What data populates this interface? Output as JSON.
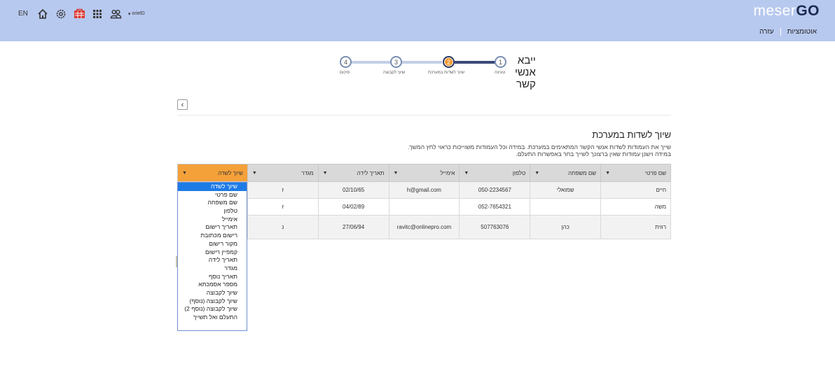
{
  "topbar": {
    "lang": "EN",
    "user_label": "orielD",
    "logo_light": "meser",
    "logo_bold": "GO",
    "nav": [
      "אוטומציות",
      "עזרה"
    ]
  },
  "wizard": {
    "title": "ייבא אנשי קשר",
    "steps": [
      {
        "num": "1",
        "label": "טעינה"
      },
      {
        "num": "2",
        "label": "שיוך לשדות במערכת"
      },
      {
        "num": "3",
        "label": "שיוך לקבוצה"
      },
      {
        "num": "4",
        "label": "סיכום"
      }
    ]
  },
  "back_glyph": "‹",
  "section": {
    "heading": "שיוך לשדות במערכת",
    "line1": "שייך את העמודות לשדות אנשי הקשר המתאימים במערכת. במידה וכל העמודות משוייכות כראוי לחץ המשך.",
    "line2": "במידה וישנן עמודות שאין ברצונך לשייך בחר באפשרות התעלם."
  },
  "table": {
    "headers": [
      "שם פרטי",
      "שם משפחה",
      "טלפון",
      "אימייל",
      "תאריך לידה",
      "מגדר",
      "שיוך לשדה"
    ],
    "rows": [
      [
        "חיים",
        "שמואלי",
        "050-2234567",
        "h@gmail.com",
        "02/10/65",
        "ז",
        ""
      ],
      [
        "משה",
        "",
        "052-7654321",
        "",
        "04/02/89",
        "ז",
        ""
      ],
      [
        "רווית",
        "כהן",
        "507763076",
        "ravitc@onlinepro.com",
        "27/06/94",
        "נ",
        ""
      ]
    ]
  },
  "dropdown": {
    "options": [
      "שיוך לשדה",
      "שם פרטי",
      "שם משפחה",
      "טלפון",
      "אימייל",
      "תאריך רישום",
      "רישום מכתובת",
      "מקור רישום",
      "קמפיין רישום",
      "תאריך לידה",
      "מגדר",
      "תאריך נוסף",
      "מספר אסמכתא",
      "שיוך לקבוצה",
      "שיוך לקבוצה (נוסף)",
      "שיוך לקבוצה (נוסף 2)",
      "התעלם ואל תשייך"
    ],
    "selected": 0
  },
  "colors": {
    "topbar": "#b8c9ef",
    "accent": "#f29a2e",
    "selected_option": "#1e7be6"
  }
}
